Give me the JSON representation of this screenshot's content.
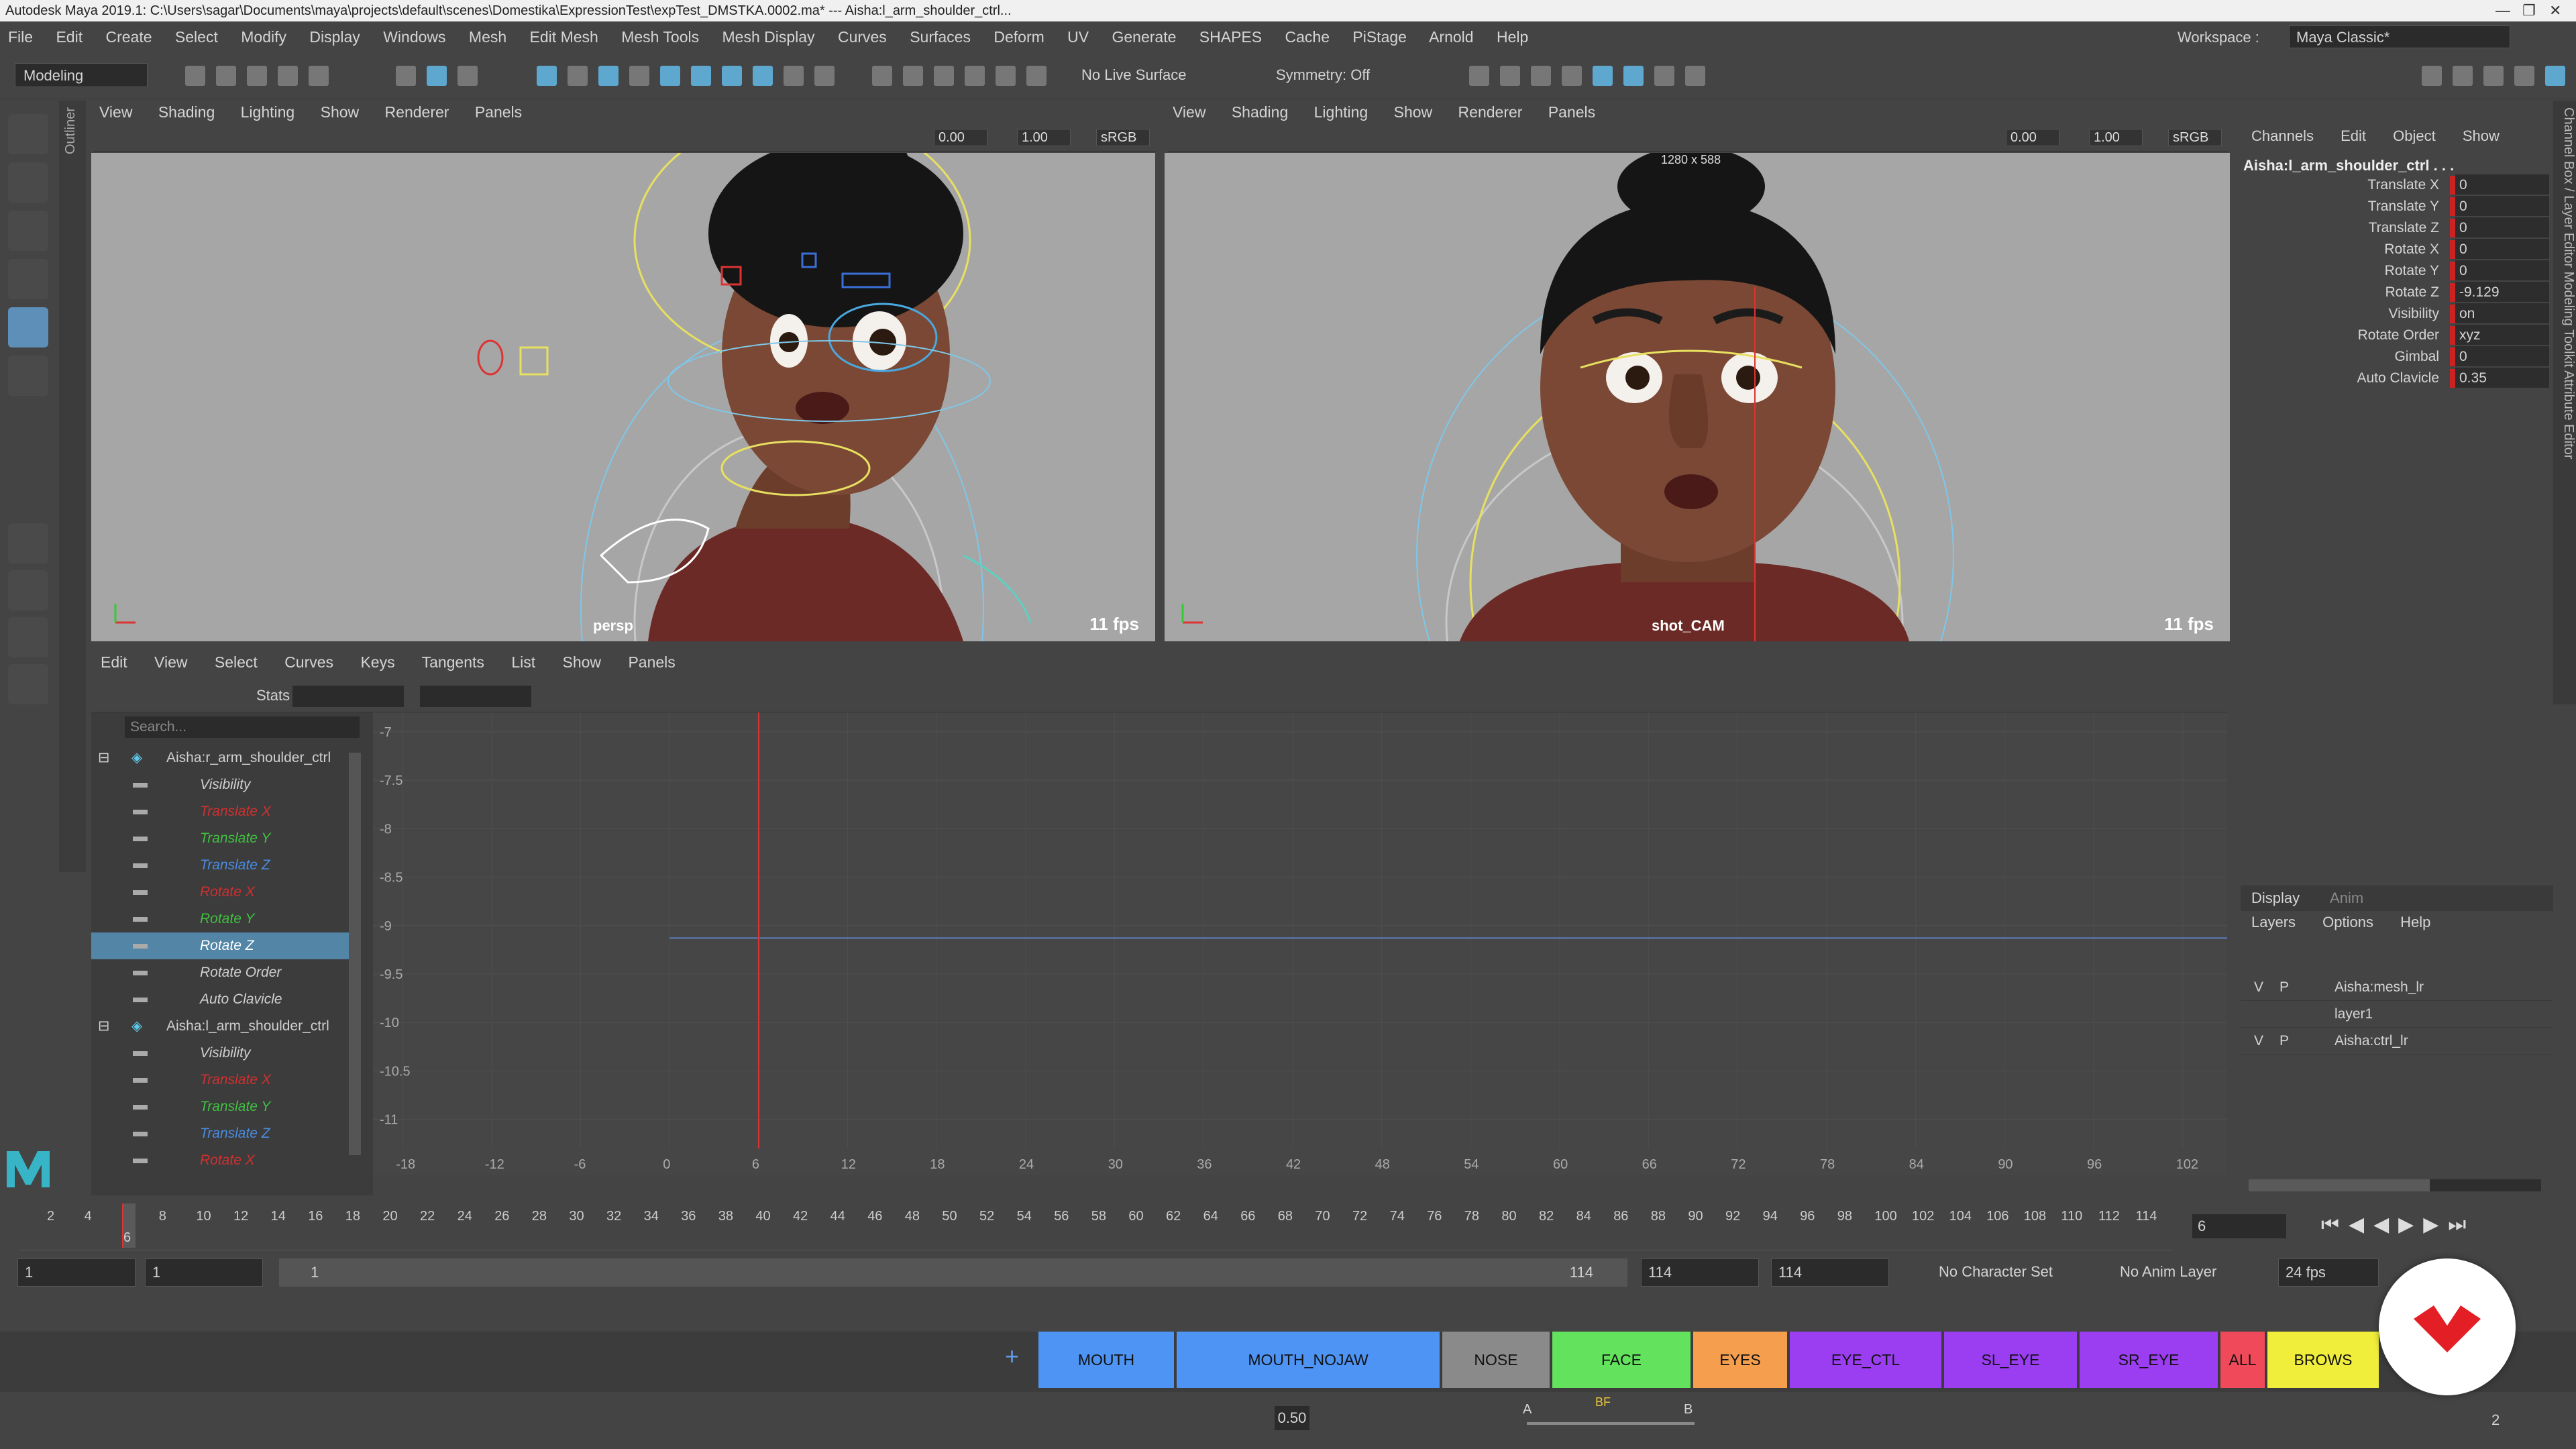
{
  "title": "Autodesk Maya 2019.1: C:\\Users\\sagar\\Documents\\maya\\projects\\default\\scenes\\Domestika\\ExpressionTest\\expTest_DMSTKA.0002.ma*  ---  Aisha:l_arm_shoulder_ctrl...",
  "menu": [
    "File",
    "Edit",
    "Create",
    "Select",
    "Modify",
    "Display",
    "Windows",
    "Mesh",
    "Edit Mesh",
    "Mesh Tools",
    "Mesh Display",
    "Curves",
    "Surfaces",
    "Deform",
    "UV",
    "Generate",
    "SHAPES",
    "Cache",
    "PiStage",
    "Arnold",
    "Help"
  ],
  "workspace": {
    "label": "Workspace :",
    "value": "Maya Classic*"
  },
  "toolbar": {
    "mode": "Modeling",
    "live_surface": "No Live Surface",
    "symmetry": "Symmetry: Off"
  },
  "outliner_tab": "Outliner",
  "viewport_menu": [
    "View",
    "Shading",
    "Lighting",
    "Show",
    "Renderer",
    "Panels"
  ],
  "viewport_left": {
    "exposure": "0.00",
    "gamma": "1.00",
    "colorspace": "sRGB",
    "camera": "persp",
    "fps": "11 fps"
  },
  "viewport_right": {
    "exposure": "0.00",
    "gamma": "1.00",
    "colorspace": "sRGB",
    "camera": "shot_CAM",
    "fps": "11 fps",
    "resolution": "1280 x 588"
  },
  "graph_menu": [
    "Edit",
    "View",
    "Select",
    "Curves",
    "Keys",
    "Tangents",
    "List",
    "Show",
    "Panels"
  ],
  "graph": {
    "stats": "Stats",
    "search_placeholder": "Search...",
    "rows": [
      {
        "label": "Aisha:r_arm_shoulder_ctrl",
        "color": "#d0d0d0",
        "node": true
      },
      {
        "label": "Visibility",
        "color": "#d0d0d0"
      },
      {
        "label": "Translate X",
        "color": "#d03030"
      },
      {
        "label": "Translate Y",
        "color": "#40c040"
      },
      {
        "label": "Translate Z",
        "color": "#4a8be0"
      },
      {
        "label": "Rotate X",
        "color": "#d03030"
      },
      {
        "label": "Rotate Y",
        "color": "#40c040"
      },
      {
        "label": "Rotate Z",
        "color": "#ffffff",
        "selected": true
      },
      {
        "label": "Rotate Order",
        "color": "#d0d0d0"
      },
      {
        "label": "Auto Clavicle",
        "color": "#d0d0d0"
      },
      {
        "label": "Aisha:l_arm_shoulder_ctrl",
        "color": "#d0d0d0",
        "node": true
      },
      {
        "label": "Visibility",
        "color": "#d0d0d0"
      },
      {
        "label": "Translate X",
        "color": "#d03030"
      },
      {
        "label": "Translate Y",
        "color": "#40c040"
      },
      {
        "label": "Translate Z",
        "color": "#4a8be0"
      },
      {
        "label": "Rotate X",
        "color": "#d03030"
      }
    ],
    "y_ticks": [
      "-7",
      "-7.5",
      "-8",
      "-8.5",
      "-9",
      "-9.5",
      "-10",
      "-10.5",
      "-11"
    ],
    "x_ticks": [
      "-18",
      "-12",
      "-6",
      "0",
      "6",
      "12",
      "18",
      "24",
      "30",
      "36",
      "42",
      "48",
      "54",
      "60",
      "66",
      "72",
      "78",
      "84",
      "90",
      "96",
      "102"
    ],
    "current_frame": 6,
    "curve_value": -9.129
  },
  "channel_box": {
    "tabs": [
      "Channels",
      "Edit",
      "Object",
      "Show"
    ],
    "object": "Aisha:l_arm_shoulder_ctrl . . .",
    "channels": [
      {
        "name": "Translate X",
        "value": "0"
      },
      {
        "name": "Translate Y",
        "value": "0"
      },
      {
        "name": "Translate Z",
        "value": "0"
      },
      {
        "name": "Rotate X",
        "value": "0"
      },
      {
        "name": "Rotate Y",
        "value": "0"
      },
      {
        "name": "Rotate Z",
        "value": "-9.129"
      },
      {
        "name": "Visibility",
        "value": "on"
      },
      {
        "name": "Rotate Order",
        "value": "xyz"
      },
      {
        "name": "Gimbal",
        "value": "0"
      },
      {
        "name": "Auto Clavicle",
        "value": "0.35"
      }
    ]
  },
  "layer_editor": {
    "tabs": [
      "Display",
      "Anim"
    ],
    "menu": [
      "Layers",
      "Options",
      "Help"
    ],
    "layers": [
      {
        "v": "V",
        "p": "P",
        "name": "Aisha:mesh_lr"
      },
      {
        "v": "",
        "p": "",
        "name": "layer1"
      },
      {
        "v": "V",
        "p": "P",
        "name": "Aisha:ctrl_lr"
      }
    ]
  },
  "side_tabs": "Channel Box / Layer Editor    Modeling Toolkit    Attribute Editor",
  "timeslider": {
    "ticks": [
      "2",
      "4",
      "6",
      "8",
      "10",
      "12",
      "14",
      "16",
      "18",
      "20",
      "22",
      "24",
      "26",
      "28",
      "30",
      "32",
      "34",
      "36",
      "38",
      "40",
      "42",
      "44",
      "46",
      "48",
      "50",
      "52",
      "54",
      "56",
      "58",
      "60",
      "62",
      "64",
      "66",
      "68",
      "70",
      "72",
      "74",
      "76",
      "78",
      "80",
      "82",
      "84",
      "86",
      "88",
      "90",
      "92",
      "94",
      "96",
      "98",
      "100",
      "102",
      "104",
      "106",
      "108",
      "110",
      "112",
      "114"
    ],
    "current": "6",
    "current_field": "6"
  },
  "range": {
    "start": "1",
    "start2": "1",
    "slider_start": "1",
    "slider_end": "114",
    "end": "114",
    "end2": "114",
    "char_set": "No Character Set",
    "anim_layer": "No Anim Layer",
    "fps": "24 fps"
  },
  "shelf": [
    {
      "label": "MOUTH",
      "color": "#4d94f5"
    },
    {
      "label": "MOUTH_NOJAW",
      "color": "#4d94f5"
    },
    {
      "label": "NOSE",
      "color": "#8a8a8a"
    },
    {
      "label": "FACE",
      "color": "#63e35d"
    },
    {
      "label": "EYES",
      "color": "#f59f4e"
    },
    {
      "label": "EYE_CTL",
      "color": "#9b3df0"
    },
    {
      "label": "SL_EYE",
      "color": "#9b3df0"
    },
    {
      "label": "SR_EYE",
      "color": "#9b3df0"
    },
    {
      "label": "ALL",
      "color": "#f04a5a"
    },
    {
      "label": "BROWS",
      "color": "#f0ee3a"
    },
    {
      "label": "",
      "color": "#f0ee3a"
    }
  ],
  "bottom": {
    "weight": "0.50",
    "a": "A",
    "bf": "BF",
    "b": "B",
    "count": "2"
  }
}
